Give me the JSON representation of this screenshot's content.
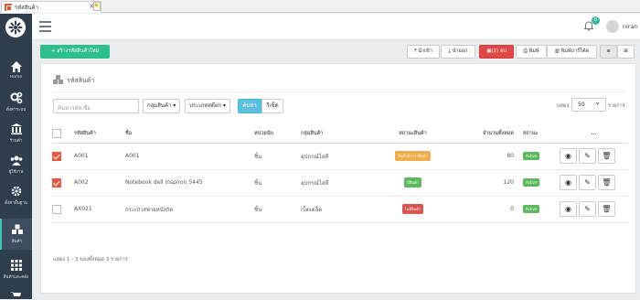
{
  "browser": {
    "tab_title": "รหัสสินค้า"
  },
  "sidebar": {
    "items": [
      {
        "label": "Home",
        "icon": "home-icon"
      },
      {
        "label": "ตั้งค่าระบบ",
        "icon": "gears-icon"
      },
      {
        "label": "ร้านค้า",
        "icon": "bank-icon"
      },
      {
        "label": "ผู้ใช้งาน",
        "icon": "users-icon"
      },
      {
        "label": "ตั้งค่าพื้นฐาน",
        "icon": "gear-icon"
      },
      {
        "label": "สินค้า",
        "icon": "cubes-icon"
      },
      {
        "label": "สินค้าและคลัง",
        "icon": "grid-icon"
      }
    ]
  },
  "header": {
    "notifications": "0",
    "username": "niran"
  },
  "toolbar": {
    "create_label": "+ สร้างรหัสสินค้าใหม่",
    "import_label": "นำเข้า",
    "export_label": "นำออก",
    "delete_label": "(2) ลบ",
    "print_label": "พิมพ์",
    "barcode_label": "พิมพ์บาร์โค้ด"
  },
  "card": {
    "title": "รหัสสินค้า"
  },
  "filters": {
    "search_placeholder": "ค้นหารหัส,ชื่อ",
    "group_label": "กลุ่มสินค้า",
    "type_label": "ประเภทสต๊อก",
    "search_button": "ค้นหา",
    "reset_button": "รีเซ็ต"
  },
  "paging": {
    "show_label": "แสดง",
    "page_size": "50",
    "items_label": "รายการ",
    "summary": "แสดง 1 - 3 ของทั้งหมด 3 รายการ"
  },
  "table": {
    "headers": [
      "รหัสสินค้า",
      "ชื่อ",
      "หน่วยนับ",
      "กลุ่มสินค้า",
      "สถานะสินค้า",
      "จำนวนทั้งหมด",
      "สถานะ",
      "..."
    ],
    "rows": [
      {
        "checked": true,
        "code": "A001",
        "name": "A001",
        "unit": "ชิ้น",
        "group": "อุปกรณ์ไอที",
        "stock_status": "สินค้าต่ำกว่าขั้นต่ำ",
        "stock_color": "#f0ad4e",
        "qty": "80",
        "status": "Active"
      },
      {
        "checked": true,
        "code": "A002",
        "name": "Notebook dell inspiron 5445",
        "unit": "ชิ้น",
        "group": "อุปกรณ์ไอที",
        "stock_status": "มีสินค้า",
        "stock_color": "#5cb85c",
        "qty": "120",
        "status": "Active"
      },
      {
        "checked": false,
        "code": "AX021",
        "name": "กระเป๋าสพายหนังกัด",
        "unit": "ชิ้น",
        "group": "เบ็ดเตล็ด",
        "stock_status": "ไม่มีสินค้า",
        "stock_color": "#d9534f",
        "qty": "0",
        "status": "Active"
      }
    ]
  }
}
